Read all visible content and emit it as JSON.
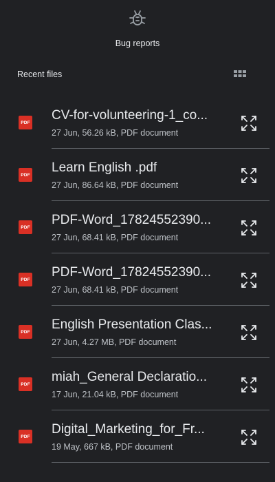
{
  "bug_reports": {
    "label": "Bug reports",
    "icon": "bug-icon"
  },
  "recent": {
    "title": "Recent files",
    "view_toggle_icon": "grid-view-icon"
  },
  "files": [
    {
      "name": "CV-for-volunteering-1_co...",
      "meta": "27 Jun, 56.26 kB, PDF document"
    },
    {
      "name": "Learn English .pdf",
      "meta": "27 Jun, 86.64 kB, PDF document"
    },
    {
      "name": "PDF-Word_17824552390...",
      "meta": "27 Jun, 68.41 kB, PDF document"
    },
    {
      "name": "PDF-Word_17824552390...",
      "meta": "27 Jun, 68.41 kB, PDF document"
    },
    {
      "name": "English Presentation Clas...",
      "meta": "27 Jun, 4.27 MB, PDF document"
    },
    {
      "name": "miah_General Declaratio...",
      "meta": "17 Jun, 21.04 kB, PDF document"
    },
    {
      "name": "Digital_Marketing_for_Fr...",
      "meta": "19 May, 667 kB, PDF document"
    }
  ],
  "file_type_badge": "PDF",
  "colors": {
    "background": "#202124",
    "pdf_red": "#d93025",
    "text_primary": "#e8eaed",
    "text_secondary": "#bdc1c6",
    "divider": "#5f6368"
  }
}
